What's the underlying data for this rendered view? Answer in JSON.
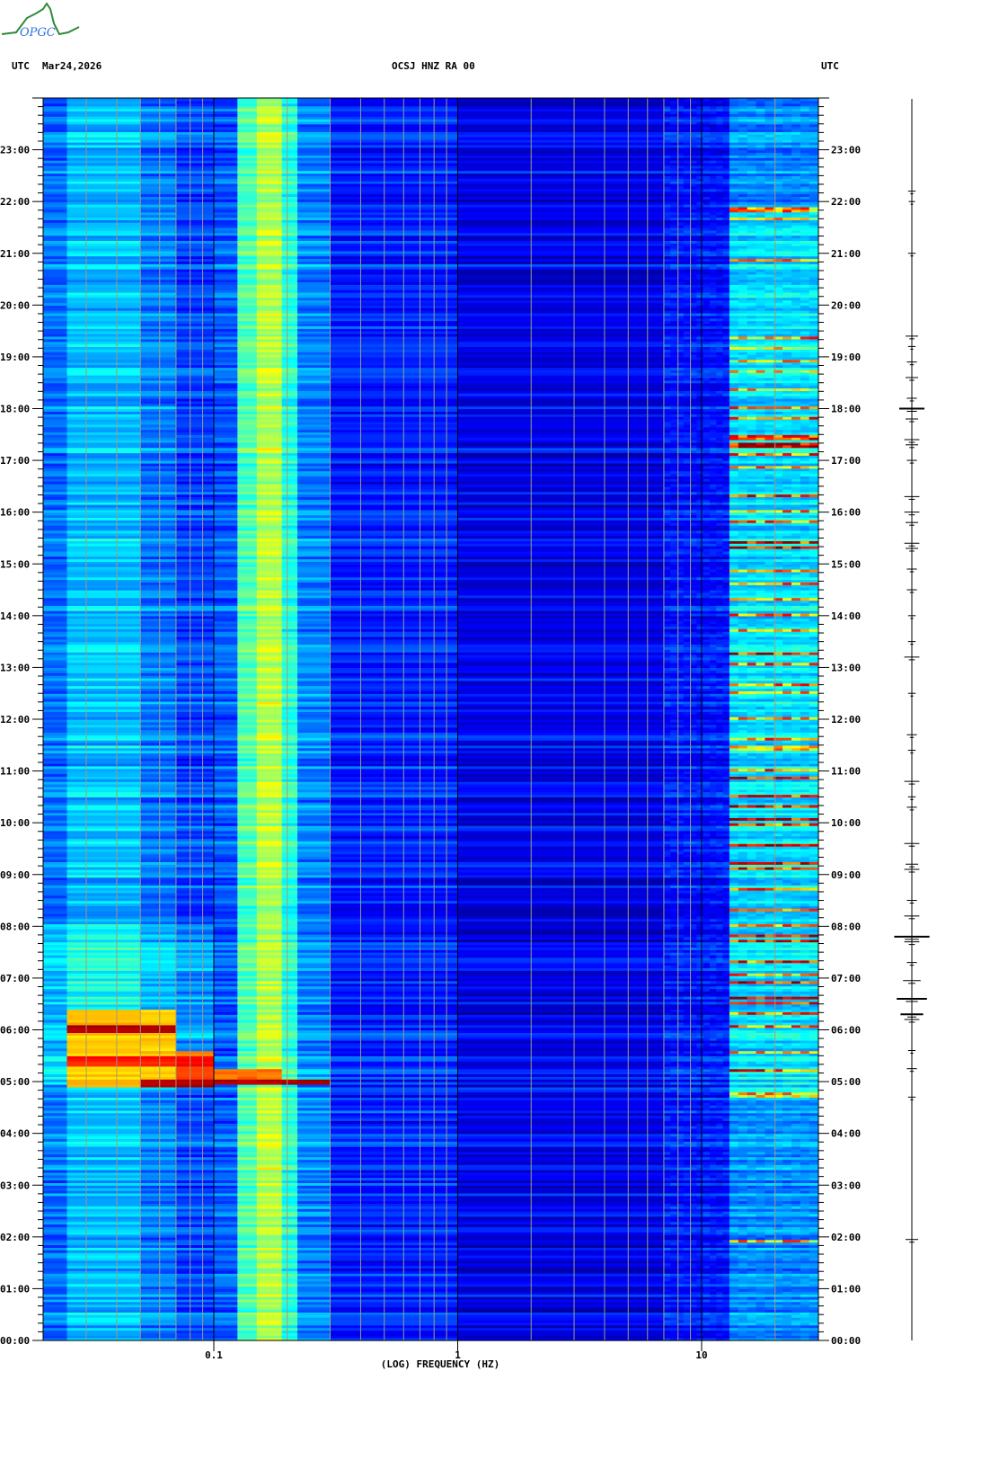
{
  "logo": {
    "text": "OPGC",
    "curve_color": "#2e8b3a",
    "text_color": "#3070e0"
  },
  "header": {
    "left_tz": "UTC",
    "date": "Mar24,2026",
    "station": "OCSJ HNZ RA 00",
    "right_tz": "UTC"
  },
  "chart_data": {
    "type": "heatmap",
    "title": "OCSJ HNZ RA 00",
    "xlabel": "(LOG) FREQUENCY (HZ)",
    "ylabel": "UTC",
    "xscale": "log",
    "xlim": [
      0.02,
      30
    ],
    "ylim": [
      0,
      24
    ],
    "x_ticks": [
      {
        "value": 0.1,
        "label": "0.1"
      },
      {
        "value": 1,
        "label": "1"
      },
      {
        "value": 10,
        "label": "10"
      }
    ],
    "y_tick_labels": [
      "00:00",
      "01:00",
      "02:00",
      "03:00",
      "04:00",
      "05:00",
      "06:00",
      "07:00",
      "08:00",
      "09:00",
      "10:00",
      "11:00",
      "12:00",
      "13:00",
      "14:00",
      "15:00",
      "16:00",
      "17:00",
      "18:00",
      "19:00",
      "20:00",
      "21:00",
      "22:00",
      "23:00"
    ],
    "grid_minor_freqs": [
      0.03,
      0.04,
      0.05,
      0.06,
      0.07,
      0.08,
      0.09,
      0.2,
      0.3,
      0.4,
      0.5,
      0.6,
      0.7,
      0.8,
      0.9,
      2,
      3,
      4,
      5,
      6,
      7,
      8,
      9,
      20
    ],
    "grid_major_freqs": [
      0.1,
      1,
      10
    ],
    "colormap": [
      "#00008b",
      "#0000ff",
      "#0080ff",
      "#00ffff",
      "#80ff80",
      "#ffff00",
      "#ff8000",
      "#ff0000",
      "#8b0000"
    ],
    "background_bands": [
      {
        "fmin": 0.02,
        "fmax": 0.025,
        "level": 0.24
      },
      {
        "fmin": 0.025,
        "fmax": 0.05,
        "level": 0.32
      },
      {
        "fmin": 0.05,
        "fmax": 0.07,
        "level": 0.25
      },
      {
        "fmin": 0.07,
        "fmax": 0.1,
        "level": 0.2
      },
      {
        "fmin": 0.1,
        "fmax": 0.125,
        "level": 0.22
      },
      {
        "fmin": 0.125,
        "fmax": 0.15,
        "level": 0.46
      },
      {
        "fmin": 0.15,
        "fmax": 0.19,
        "level": 0.56
      },
      {
        "fmin": 0.19,
        "fmax": 0.22,
        "level": 0.42
      },
      {
        "fmin": 0.22,
        "fmax": 0.3,
        "level": 0.26
      },
      {
        "fmin": 0.3,
        "fmax": 1,
        "level": 0.16
      },
      {
        "fmin": 1,
        "fmax": 7,
        "level": 0.11
      },
      {
        "fmin": 7,
        "fmax": 13,
        "level": 0.15
      },
      {
        "fmin": 13,
        "fmax": 30,
        "level": 0.27
      }
    ],
    "earthquake": {
      "time_h": 4.92,
      "blocks": [
        {
          "fmin": 0.025,
          "fmax": 0.07,
          "t0": 4.9,
          "t1": 6.35,
          "level": 0.72
        },
        {
          "fmin": 0.025,
          "fmax": 0.07,
          "t0": 5.95,
          "t1": 6.05,
          "level": 1.0
        },
        {
          "fmin": 0.025,
          "fmax": 0.1,
          "t0": 5.3,
          "t1": 5.45,
          "level": 0.9
        },
        {
          "fmin": 0.07,
          "fmax": 0.1,
          "t0": 4.9,
          "t1": 5.55,
          "level": 0.82
        },
        {
          "fmin": 0.05,
          "fmax": 0.1,
          "t0": 4.9,
          "t1": 5.0,
          "level": 1.0
        },
        {
          "fmin": 0.1,
          "fmax": 0.2,
          "t0": 4.92,
          "t1": 5.2,
          "level": 0.8
        },
        {
          "fmin": 0.1,
          "fmax": 0.45,
          "t0": 4.92,
          "t1": 5.0,
          "level": 1.0
        },
        {
          "fmin": 0.45,
          "fmax": 0.9,
          "t0": 4.92,
          "t1": 4.98,
          "level": 0.7
        },
        {
          "fmin": 0.9,
          "fmax": 3,
          "t0": 4.92,
          "t1": 4.96,
          "level": 0.4
        }
      ]
    },
    "hf_events": [
      {
        "t": 21.82,
        "level": 0.8
      },
      {
        "t": 21.65,
        "level": 0.75
      },
      {
        "t": 20.85,
        "level": 0.8
      },
      {
        "t": 19.35,
        "level": 0.8
      },
      {
        "t": 19.15,
        "level": 0.7
      },
      {
        "t": 18.9,
        "level": 0.75
      },
      {
        "t": 18.7,
        "level": 0.7
      },
      {
        "t": 18.35,
        "level": 0.75
      },
      {
        "t": 18.0,
        "level": 0.9
      },
      {
        "t": 17.8,
        "level": 0.85
      },
      {
        "t": 17.42,
        "level": 0.95
      },
      {
        "t": 17.28,
        "level": 1.0
      },
      {
        "t": 17.1,
        "level": 0.85
      },
      {
        "t": 16.85,
        "level": 0.8
      },
      {
        "t": 16.3,
        "level": 0.9
      },
      {
        "t": 16.0,
        "level": 0.8
      },
      {
        "t": 15.8,
        "level": 0.8
      },
      {
        "t": 15.4,
        "level": 0.95
      },
      {
        "t": 15.3,
        "level": 1.0
      },
      {
        "t": 14.85,
        "level": 0.8
      },
      {
        "t": 14.6,
        "level": 0.8
      },
      {
        "t": 14.3,
        "level": 0.85
      },
      {
        "t": 14.0,
        "level": 0.8
      },
      {
        "t": 13.7,
        "level": 0.8
      },
      {
        "t": 13.25,
        "level": 0.95
      },
      {
        "t": 13.05,
        "level": 0.85
      },
      {
        "t": 12.65,
        "level": 0.85
      },
      {
        "t": 12.5,
        "level": 0.8
      },
      {
        "t": 12.0,
        "level": 0.8
      },
      {
        "t": 11.6,
        "level": 0.8
      },
      {
        "t": 11.42,
        "level": 0.75
      },
      {
        "t": 11.0,
        "level": 0.85
      },
      {
        "t": 10.85,
        "level": 0.95
      },
      {
        "t": 10.5,
        "level": 0.95
      },
      {
        "t": 10.3,
        "level": 0.95
      },
      {
        "t": 10.05,
        "level": 1.0
      },
      {
        "t": 9.95,
        "level": 0.9
      },
      {
        "t": 9.55,
        "level": 1.0
      },
      {
        "t": 9.2,
        "level": 1.0
      },
      {
        "t": 9.1,
        "level": 0.95
      },
      {
        "t": 8.7,
        "level": 0.85
      },
      {
        "t": 8.3,
        "level": 0.85
      },
      {
        "t": 8.0,
        "level": 0.85
      },
      {
        "t": 7.8,
        "level": 1.0
      },
      {
        "t": 7.7,
        "level": 0.95
      },
      {
        "t": 7.3,
        "level": 0.9
      },
      {
        "t": 7.05,
        "level": 0.8
      },
      {
        "t": 6.9,
        "level": 0.95
      },
      {
        "t": 6.6,
        "level": 1.0
      },
      {
        "t": 6.5,
        "level": 0.95
      },
      {
        "t": 6.3,
        "level": 0.9
      },
      {
        "t": 6.05,
        "level": 0.85
      },
      {
        "t": 5.55,
        "level": 0.8
      },
      {
        "t": 5.2,
        "level": 0.9
      },
      {
        "t": 4.72,
        "level": 0.8
      },
      {
        "t": 1.9,
        "level": 0.85
      }
    ],
    "seismogram_trace": {
      "color": "#000000",
      "events": [
        {
          "t": 22.2,
          "amp": 0.3
        },
        {
          "t": 22.0,
          "amp": 0.25
        },
        {
          "t": 21.0,
          "amp": 0.3
        },
        {
          "t": 19.4,
          "amp": 0.5
        },
        {
          "t": 19.2,
          "amp": 0.3
        },
        {
          "t": 18.9,
          "amp": 0.4
        },
        {
          "t": 18.6,
          "amp": 0.5
        },
        {
          "t": 18.2,
          "amp": 0.4
        },
        {
          "t": 18.0,
          "amp": 1.0
        },
        {
          "t": 17.8,
          "amp": 0.5
        },
        {
          "t": 17.4,
          "amp": 0.6
        },
        {
          "t": 17.3,
          "amp": 0.5
        },
        {
          "t": 17.0,
          "amp": 0.4
        },
        {
          "t": 16.3,
          "amp": 0.6
        },
        {
          "t": 16.0,
          "amp": 0.6
        },
        {
          "t": 15.8,
          "amp": 0.5
        },
        {
          "t": 15.4,
          "amp": 0.6
        },
        {
          "t": 15.3,
          "amp": 0.5
        },
        {
          "t": 14.9,
          "amp": 0.4
        },
        {
          "t": 14.5,
          "amp": 0.4
        },
        {
          "t": 14.0,
          "amp": 0.3
        },
        {
          "t": 13.5,
          "amp": 0.3
        },
        {
          "t": 13.2,
          "amp": 0.6
        },
        {
          "t": 12.5,
          "amp": 0.3
        },
        {
          "t": 11.7,
          "amp": 0.4
        },
        {
          "t": 11.4,
          "amp": 0.3
        },
        {
          "t": 10.8,
          "amp": 0.6
        },
        {
          "t": 10.5,
          "amp": 0.3
        },
        {
          "t": 10.3,
          "amp": 0.4
        },
        {
          "t": 9.6,
          "amp": 0.6
        },
        {
          "t": 9.2,
          "amp": 0.5
        },
        {
          "t": 9.1,
          "amp": 0.6
        },
        {
          "t": 8.5,
          "amp": 0.4
        },
        {
          "t": 8.2,
          "amp": 0.6
        },
        {
          "t": 7.8,
          "amp": 1.4
        },
        {
          "t": 7.7,
          "amp": 0.6
        },
        {
          "t": 7.3,
          "amp": 0.4
        },
        {
          "t": 6.95,
          "amp": 0.7
        },
        {
          "t": 6.6,
          "amp": 1.2
        },
        {
          "t": 6.3,
          "amp": 0.9
        },
        {
          "t": 6.2,
          "amp": 0.6
        },
        {
          "t": 5.6,
          "amp": 0.3
        },
        {
          "t": 5.25,
          "amp": 0.4
        },
        {
          "t": 4.7,
          "amp": 0.3
        },
        {
          "t": 1.95,
          "amp": 0.5
        }
      ]
    }
  }
}
